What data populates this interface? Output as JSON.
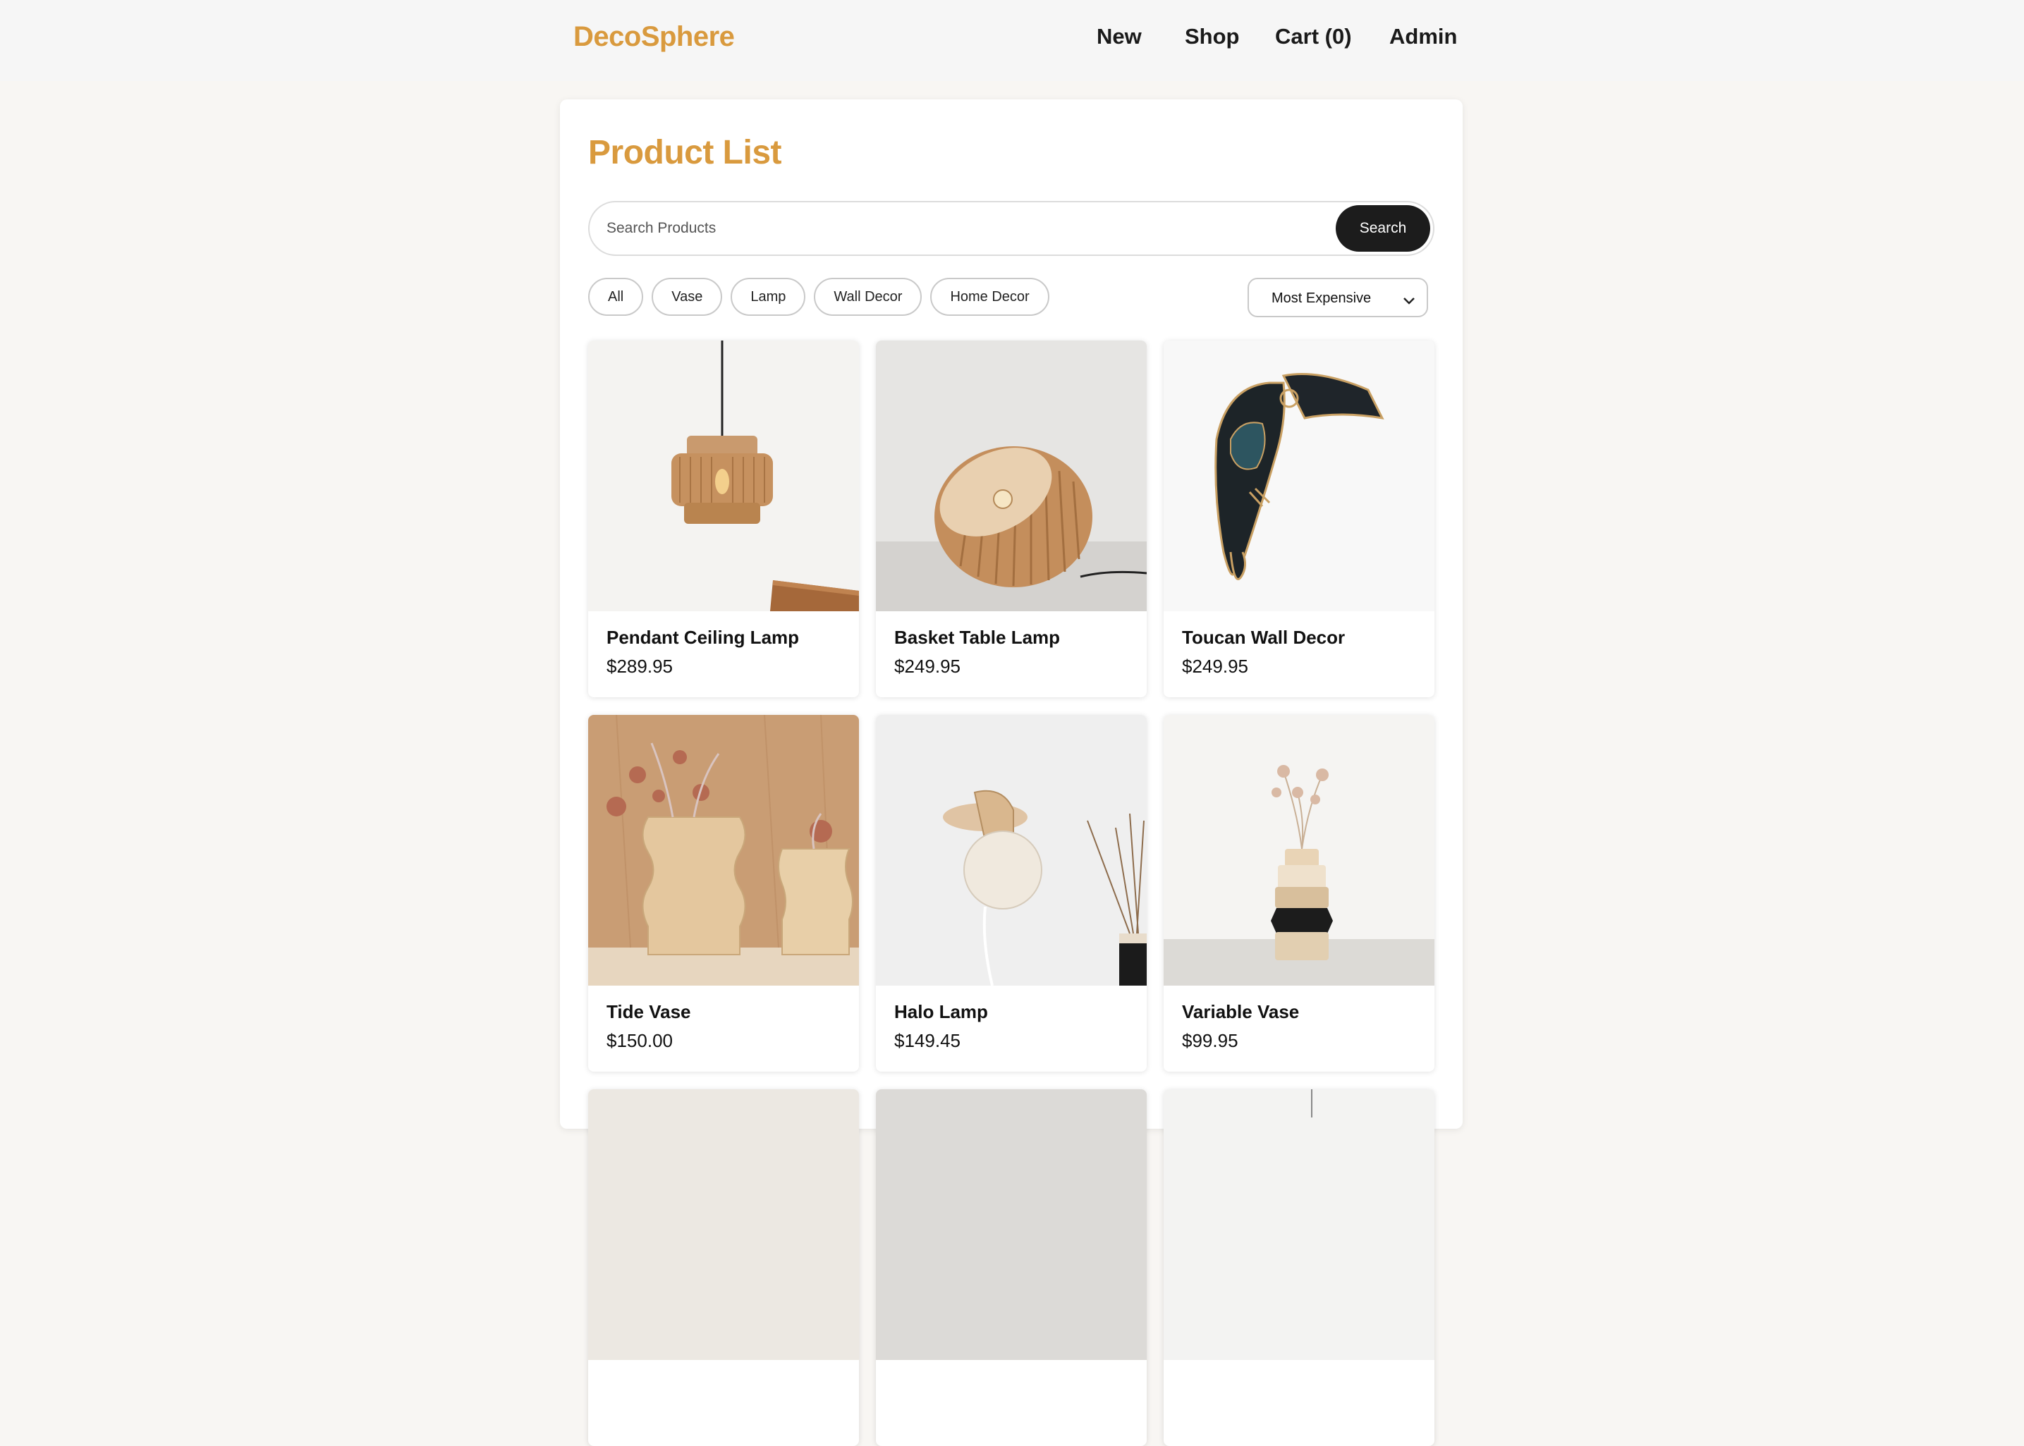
{
  "header": {
    "brand": "DecoSphere",
    "nav": {
      "new": "New",
      "shop": "Shop",
      "cart": "Cart (0)",
      "admin": "Admin"
    }
  },
  "page": {
    "title": "Product List"
  },
  "search": {
    "placeholder": "Search Products",
    "value": "",
    "button": "Search"
  },
  "filters": [
    "All",
    "Vase",
    "Lamp",
    "Wall Decor",
    "Home Decor"
  ],
  "sort": {
    "selected": "Most Expensive"
  },
  "products": [
    {
      "name": "Pendant Ceiling Lamp",
      "price": "$289.95"
    },
    {
      "name": "Basket Table Lamp",
      "price": "$249.95"
    },
    {
      "name": "Toucan Wall Decor",
      "price": "$249.95"
    },
    {
      "name": "Tide Vase",
      "price": "$150.00"
    },
    {
      "name": "Halo Lamp",
      "price": "$149.45"
    },
    {
      "name": "Variable Vase",
      "price": "$99.95"
    }
  ],
  "colors": {
    "accent": "#d99a3e",
    "dark_button": "#1c1c1c",
    "page_bg": "#f8f6f3"
  }
}
